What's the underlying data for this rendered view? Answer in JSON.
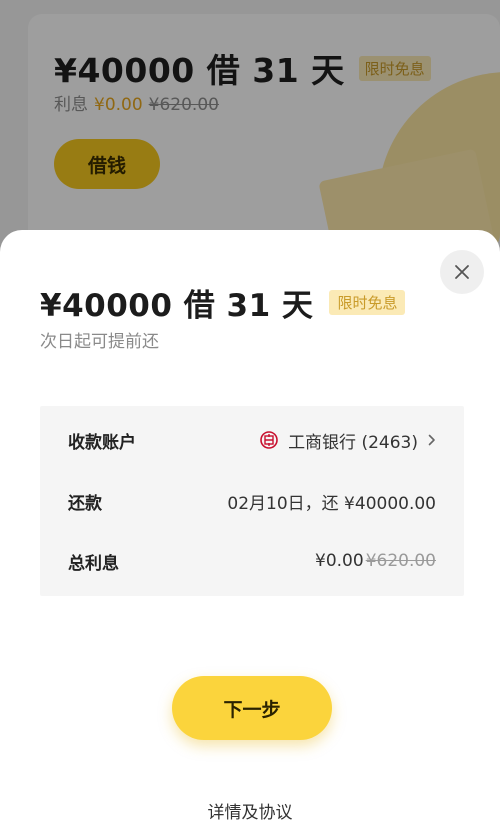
{
  "background": {
    "amount_title": "¥40000 借 31 天",
    "badge": "限时免息",
    "interest_label": "利息",
    "interest_value": "¥0.00",
    "interest_original": "¥620.00",
    "borrow_button": "借钱"
  },
  "sheet": {
    "title": "¥40000 借 31 天",
    "badge": "限时免息",
    "subtitle": "次日起可提前还",
    "rows": {
      "account": {
        "label": "收款账户",
        "value": "工商银行 (2463)",
        "icon": "icbc-bank-icon"
      },
      "repay": {
        "label": "还款",
        "value": "02月10日，还 ¥40000.00"
      },
      "interest": {
        "label": "总利息",
        "value": "¥0.00",
        "original": "¥620.00"
      }
    },
    "next_button": "下一步",
    "details_link": "详情及协议"
  },
  "colors": {
    "accent": "#fbd43c",
    "badge_bg": "#fbeab6",
    "badge_text": "#c99b2a",
    "interest_highlight": "#e8a820",
    "bank_red": "#c8102e"
  }
}
